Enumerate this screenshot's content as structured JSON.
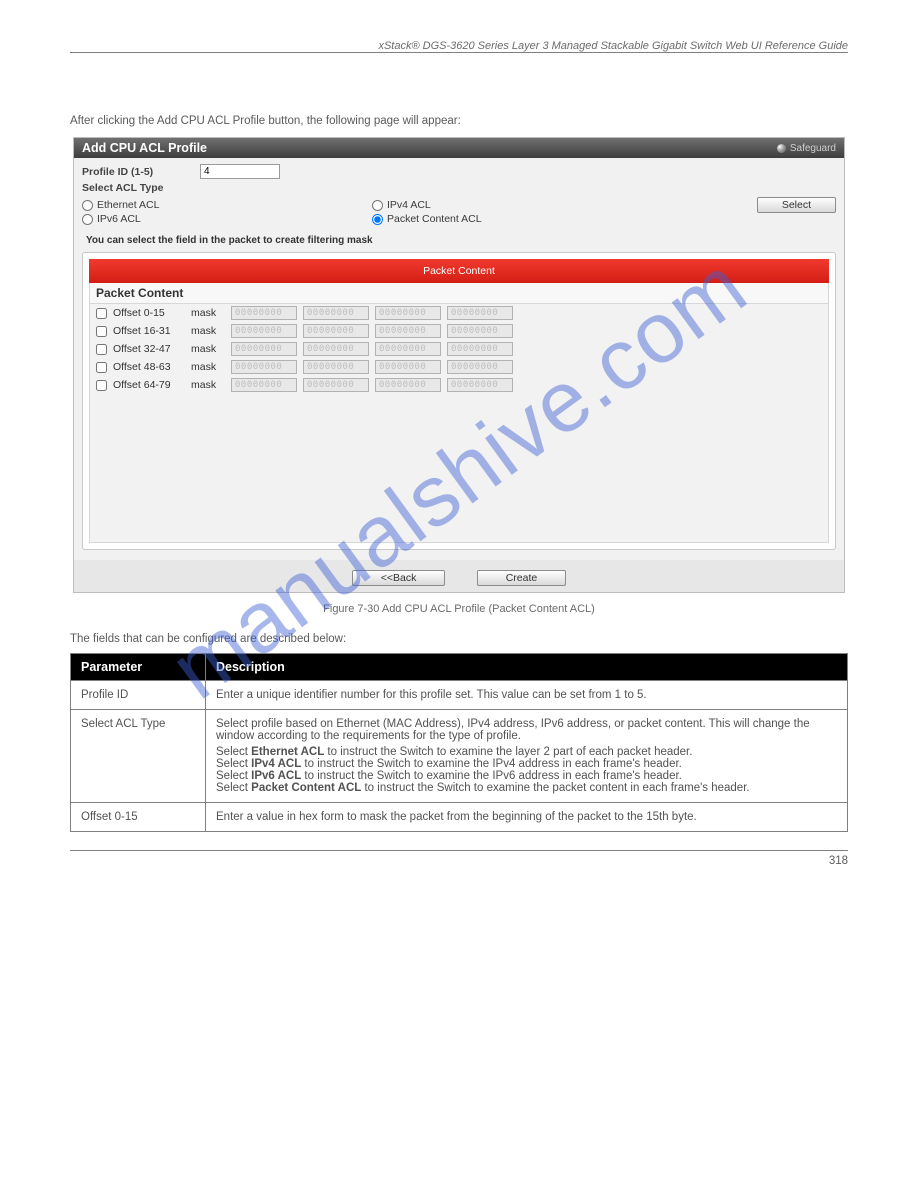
{
  "header": {
    "device_series": "xStack® DGS-3620 Series Layer 3 Managed Stackable Gigabit Switch Web UI Reference Guide"
  },
  "watermark": "manualshive.com",
  "intro_before_bold": "The fields that can be configured are described below:",
  "intro_bold": "After clicking the Add CPU ACL Profile button, the following page will appear:",
  "shot": {
    "title": "Add CPU ACL Profile",
    "safeguard": "Safeguard",
    "profile_id_label": "Profile ID (1-5)",
    "profile_id_value": "4",
    "select_acl_type": "Select ACL Type",
    "radios": {
      "ethernet": "Ethernet ACL",
      "ipv6": "IPv6 ACL",
      "ipv4": "IPv4 ACL",
      "packet": "Packet Content ACL"
    },
    "select_btn": "Select",
    "instr": "You can select the field in the packet to create filtering mask",
    "red_bar": "Packet Content",
    "pc_title": "Packet Content",
    "mask_label": "mask",
    "hex_placeholder": "00000000",
    "offsets": [
      "Offset 0-15",
      "Offset 16-31",
      "Offset 32-47",
      "Offset 48-63",
      "Offset 64-79"
    ],
    "back_btn": "<<Back",
    "create_btn": "Create"
  },
  "figure_caption": "Figure 7-30 Add CPU ACL Profile (Packet Content ACL)",
  "lead_in": "The fields that can be configured are described below:",
  "table": {
    "head_param": "Parameter",
    "head_desc": "Description",
    "rows": [
      {
        "param": "Profile ID",
        "desc": "Enter a unique identifier number for this profile set. This value can be set from 1 to 5."
      },
      {
        "param": "Select ACL Type",
        "desc_pre": "Select profile based on Ethernet (MAC Address), IPv4 address, IPv6 address, or packet content. This will change the window according to the requirements for the type of profile.",
        "bullets": [
          {
            "lead_bold": "Ethernet ACL",
            "text": " to instruct the Switch to examine the layer 2 part of each packet header."
          },
          {
            "lead_bold": "IPv4 ACL",
            "text": " to instruct the Switch to examine the IPv4 address in each frame's header."
          },
          {
            "lead_bold": "IPv6 ACL",
            "text": " to instruct the Switch to examine the IPv6 address in each frame's header."
          },
          {
            "lead_bold": "Packet Content ACL",
            "text": " to instruct the Switch to examine the packet content in each frame's header."
          }
        ],
        "select_prefix": "Select "
      },
      {
        "param": "Offset 0-15",
        "desc": "Enter a value in hex form to mask the packet from the beginning of the packet to the 15th byte."
      }
    ]
  },
  "footer": {
    "page": "318"
  }
}
